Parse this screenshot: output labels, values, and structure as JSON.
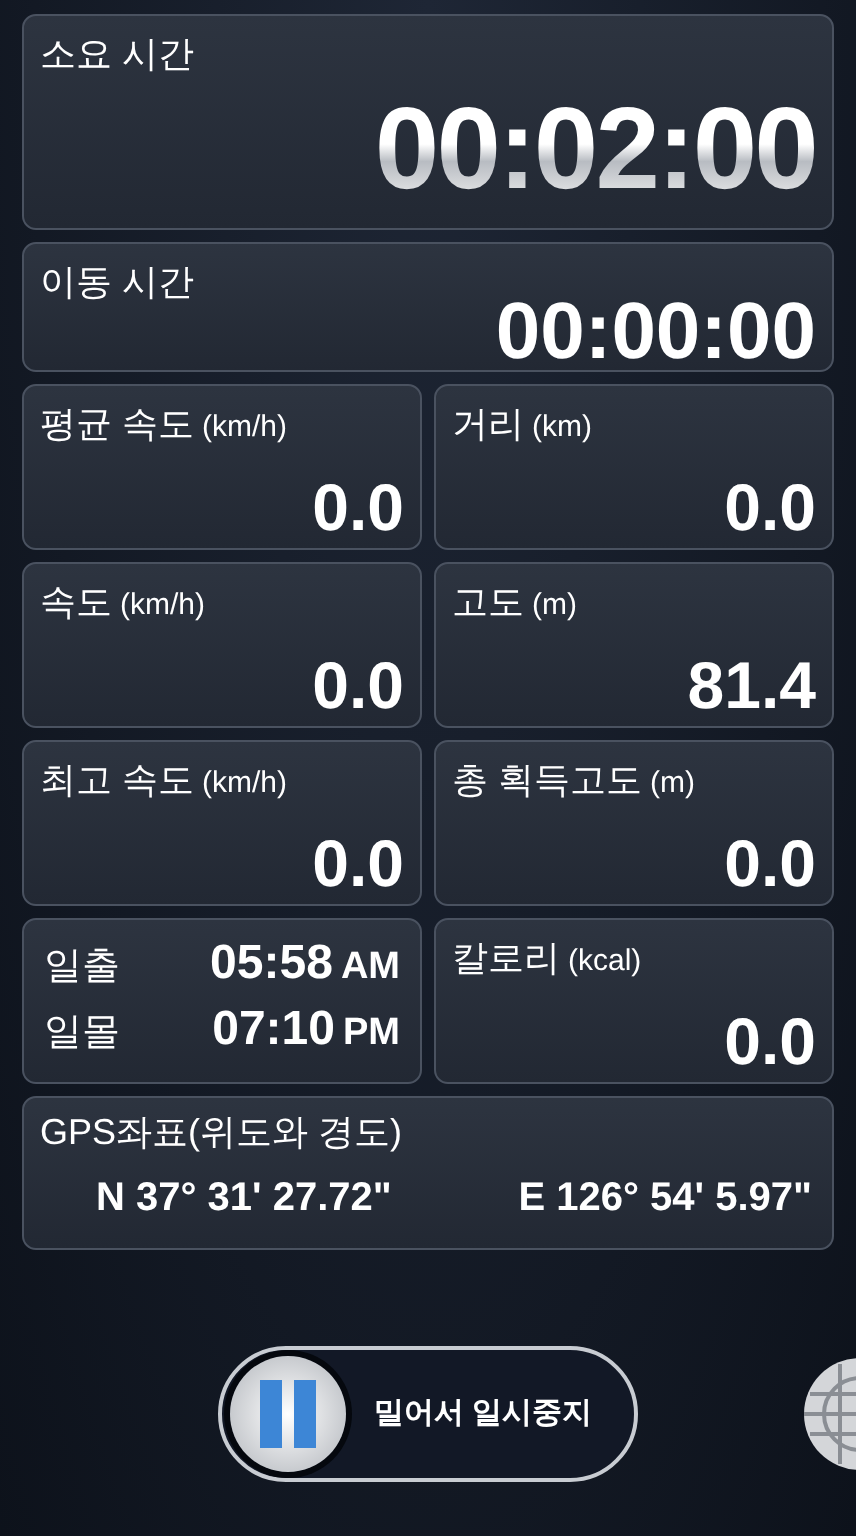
{
  "elapsed": {
    "label": "소요 시간",
    "value": "00:02:00"
  },
  "moving": {
    "label": "이동 시간",
    "value": "00:00:00"
  },
  "metrics": [
    {
      "kind": "metric",
      "label": "평균 속도",
      "unit": "(km/h)",
      "value": "0.0"
    },
    {
      "kind": "metric",
      "label": "거리",
      "unit": "(km)",
      "value": "0.0"
    },
    {
      "kind": "metric",
      "label": "속도",
      "unit": "(km/h)",
      "value": "0.0"
    },
    {
      "kind": "metric",
      "label": "고도",
      "unit": "(m)",
      "value": "81.4"
    },
    {
      "kind": "metric",
      "label": "최고 속도",
      "unit": "(km/h)",
      "value": "0.0"
    },
    {
      "kind": "metric",
      "label": "총 획득고도",
      "unit": "(m)",
      "value": "0.0"
    },
    {
      "kind": "sun",
      "rows": [
        {
          "label": "일출",
          "time": "05:58",
          "ampm": "AM"
        },
        {
          "label": "일몰",
          "time": "07:10",
          "ampm": "PM"
        }
      ]
    },
    {
      "kind": "metric",
      "label": "칼로리",
      "unit": "(kcal)",
      "value": "0.0"
    }
  ],
  "gps": {
    "label": "GPS좌표(위도와 경도)",
    "latitude": "N 37° 31' 27.72\"",
    "longitude": "E 126° 54' 5.97\""
  },
  "pause_slider": {
    "label": "밀어서 일시중지",
    "level": 0
  }
}
